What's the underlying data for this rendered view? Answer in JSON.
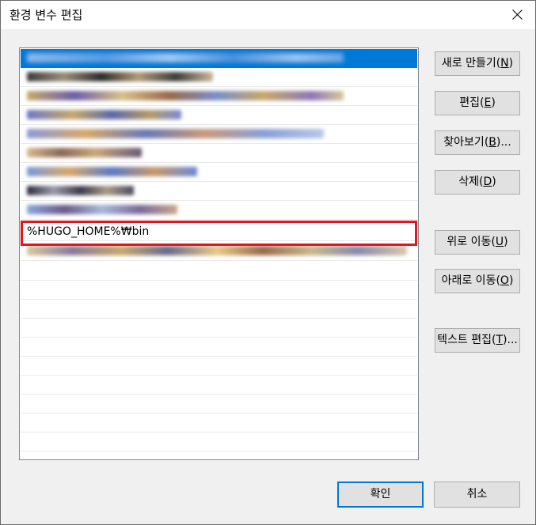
{
  "window": {
    "title": "환경 변수 편집"
  },
  "list": {
    "items": [
      {
        "text": "",
        "redacted": true,
        "selected": true
      },
      {
        "text": "",
        "redacted": true
      },
      {
        "text": "",
        "redacted": true
      },
      {
        "text": "",
        "redacted": true
      },
      {
        "text": "",
        "redacted": true
      },
      {
        "text": "",
        "redacted": true
      },
      {
        "text": "",
        "redacted": true
      },
      {
        "text": "",
        "redacted": true
      },
      {
        "text": "",
        "redacted": true
      },
      {
        "text": "%HUGO_HOME%₩bin",
        "redacted": false
      },
      {
        "text": "",
        "redacted": true
      }
    ]
  },
  "buttons": {
    "new": {
      "label": "새로 만들기(",
      "key": "N",
      "suffix": ")"
    },
    "edit": {
      "label": "편집(",
      "key": "E",
      "suffix": ")"
    },
    "browse": {
      "label": "찾아보기(",
      "key": "B",
      "suffix": ")..."
    },
    "delete": {
      "label": "삭제(",
      "key": "D",
      "suffix": ")"
    },
    "move_up": {
      "label": "위로 이동(",
      "key": "U",
      "suffix": ")"
    },
    "move_down": {
      "label": "아래로 이동(",
      "key": "O",
      "suffix": ")"
    },
    "edit_text": {
      "label": "텍스트 편집(",
      "key": "T",
      "suffix": ")..."
    },
    "ok": {
      "label": "확인"
    },
    "cancel": {
      "label": "취소"
    }
  },
  "colors": {
    "selection": "#0078d7",
    "highlight_frame": "#e0171f",
    "dialog_bg": "#f0f0f0"
  }
}
